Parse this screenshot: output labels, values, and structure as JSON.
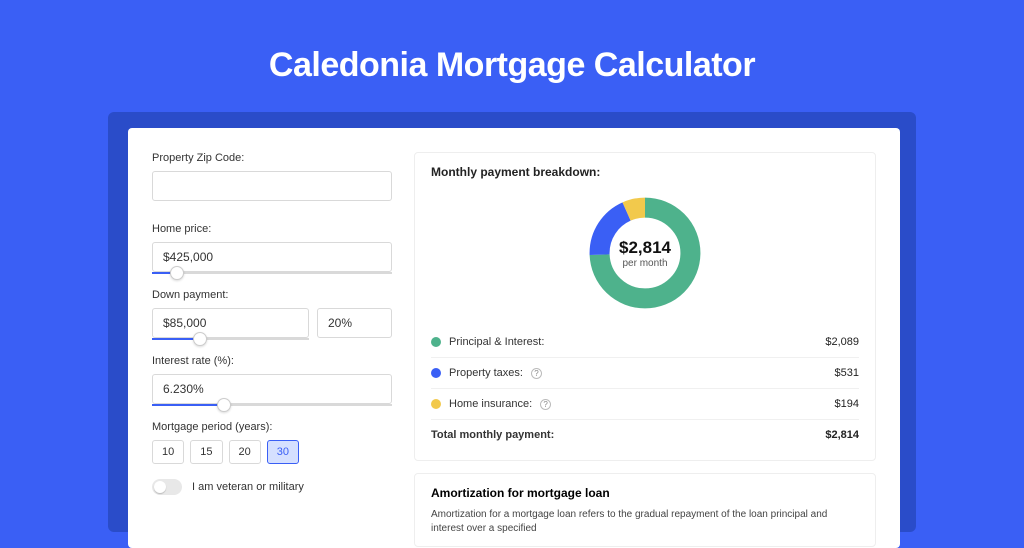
{
  "page_title": "Caledonia Mortgage Calculator",
  "colors": {
    "principal": "#4eb28c",
    "taxes": "#3a5ff5",
    "insurance": "#f2c94c"
  },
  "form": {
    "zip_label": "Property Zip Code:",
    "zip_value": "",
    "home_price_label": "Home price:",
    "home_price_value": "$425,000",
    "down_label": "Down payment:",
    "down_value": "$85,000",
    "down_pct": "20%",
    "rate_label": "Interest rate (%):",
    "rate_value": "6.230%",
    "period_label": "Mortgage period (years):",
    "periods": [
      "10",
      "15",
      "20",
      "30"
    ],
    "period_active": "30",
    "veteran_label": "I am veteran or military"
  },
  "breakdown": {
    "title": "Monthly payment breakdown:",
    "amount": "$2,814",
    "per_month": "per month",
    "rows": [
      {
        "label": "Principal & Interest:",
        "value": "$2,089",
        "color": "#4eb28c"
      },
      {
        "label": "Property taxes:",
        "value": "$531",
        "color": "#3a5ff5",
        "info": true
      },
      {
        "label": "Home insurance:",
        "value": "$194",
        "color": "#f2c94c",
        "info": true
      }
    ],
    "total_label": "Total monthly payment:",
    "total_value": "$2,814"
  },
  "amortization": {
    "title": "Amortization for mortgage loan",
    "text": "Amortization for a mortgage loan refers to the gradual repayment of the loan principal and interest over a specified"
  },
  "chart_data": {
    "type": "pie",
    "title": "Monthly payment breakdown:",
    "series": [
      {
        "name": "Principal & Interest",
        "value": 2089,
        "color": "#4eb28c"
      },
      {
        "name": "Property taxes",
        "value": 531,
        "color": "#3a5ff5"
      },
      {
        "name": "Home insurance",
        "value": 194,
        "color": "#f2c94c"
      }
    ],
    "total": 2814,
    "center_label": "$2,814 per month"
  }
}
